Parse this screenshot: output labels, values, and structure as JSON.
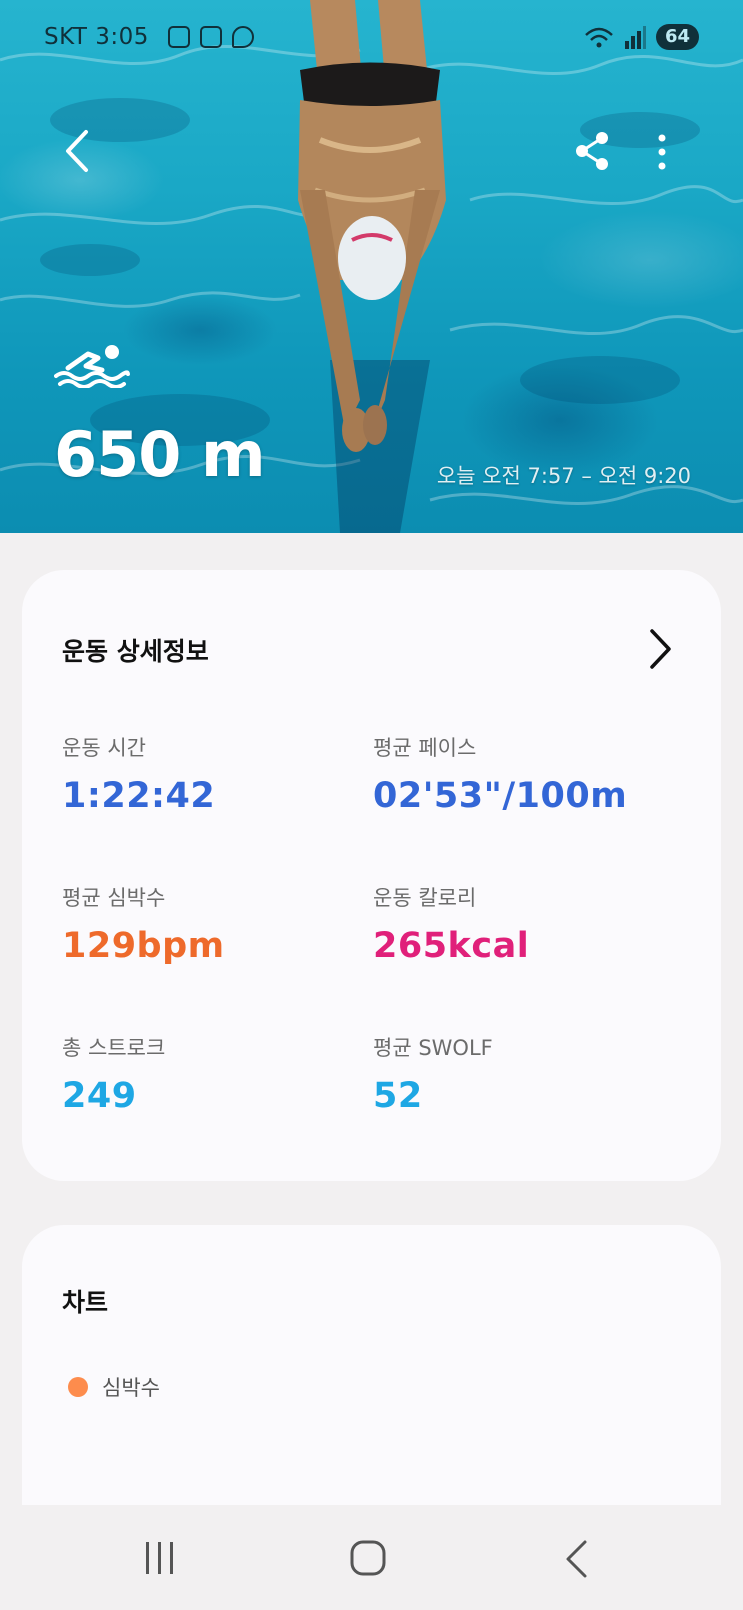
{
  "status_bar": {
    "carrier_time": "SKT 3:05",
    "battery": "64",
    "app_icons": [
      "notification-app-icon",
      "instagram-icon",
      "messenger-icon"
    ],
    "right_icons": [
      "wifi-5g-icon",
      "signal-icon"
    ]
  },
  "hero": {
    "activity_icon": "swimming-icon",
    "distance": "650 m",
    "time_range": "오늘 오전 7:57 – 오전 9:20"
  },
  "details_card": {
    "title": "운동 상세정보",
    "metrics": [
      {
        "label": "운동 시간",
        "value": "1:22:42",
        "color": "#3366d6"
      },
      {
        "label": "평균 페이스",
        "value": "02'53\"/100m",
        "color": "#3366d6"
      },
      {
        "label": "평균 심박수",
        "value": "129bpm",
        "color": "#ee6a2b"
      },
      {
        "label": "운동 칼로리",
        "value": "265kcal",
        "color": "#e0207a"
      },
      {
        "label": "총 스트로크",
        "value": "249",
        "color": "#1ea7e4"
      },
      {
        "label": "평균 SWOLF",
        "value": "52",
        "color": "#1ea7e4"
      }
    ]
  },
  "chart_card": {
    "title": "차트",
    "legend": [
      {
        "label": "심박수",
        "color": "#fd8c4d"
      }
    ]
  },
  "nav_bar": {
    "icons": [
      "recent-apps-icon",
      "home-icon",
      "back-icon"
    ]
  }
}
